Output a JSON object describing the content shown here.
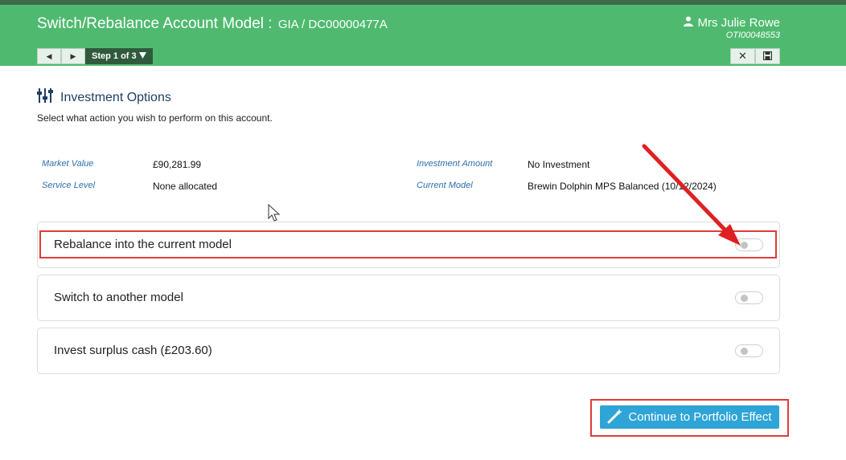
{
  "header": {
    "title": "Switch/Rebalance Account Model : ",
    "subtitle": "GIA / DC00000477A",
    "user_name": "Mrs Julie Rowe",
    "user_id": "OTI00048553",
    "step_label": "Step 1 of 3",
    "colors": {
      "bar": "#4fba6f",
      "step": "#2f5a3c"
    }
  },
  "section": {
    "title": "Investment Options",
    "instruction": "Select what action you wish to perform on this account."
  },
  "info": {
    "market_value_label": "Market Value",
    "market_value": "£90,281.99",
    "service_level_label": "Service Level",
    "service_level": "None allocated",
    "investment_amount_label": "Investment Amount",
    "investment_amount": "No Investment",
    "current_model_label": "Current Model",
    "current_model": "Brewin Dolphin MPS Balanced (10/12/2024)"
  },
  "options": [
    {
      "label": "Rebalance into the current model",
      "enabled": false
    },
    {
      "label": "Switch to another model",
      "enabled": false
    },
    {
      "label": "Invest surplus cash (£203.60)",
      "enabled": false
    }
  ],
  "continue_button": "Continue to Portfolio Effect",
  "icons": {
    "prev": "triangle-left-icon",
    "next": "triangle-right-icon",
    "close": "close-icon",
    "save": "save-icon",
    "user": "user-icon",
    "options": "sliders-icon",
    "magic": "magic-wand-icon"
  }
}
